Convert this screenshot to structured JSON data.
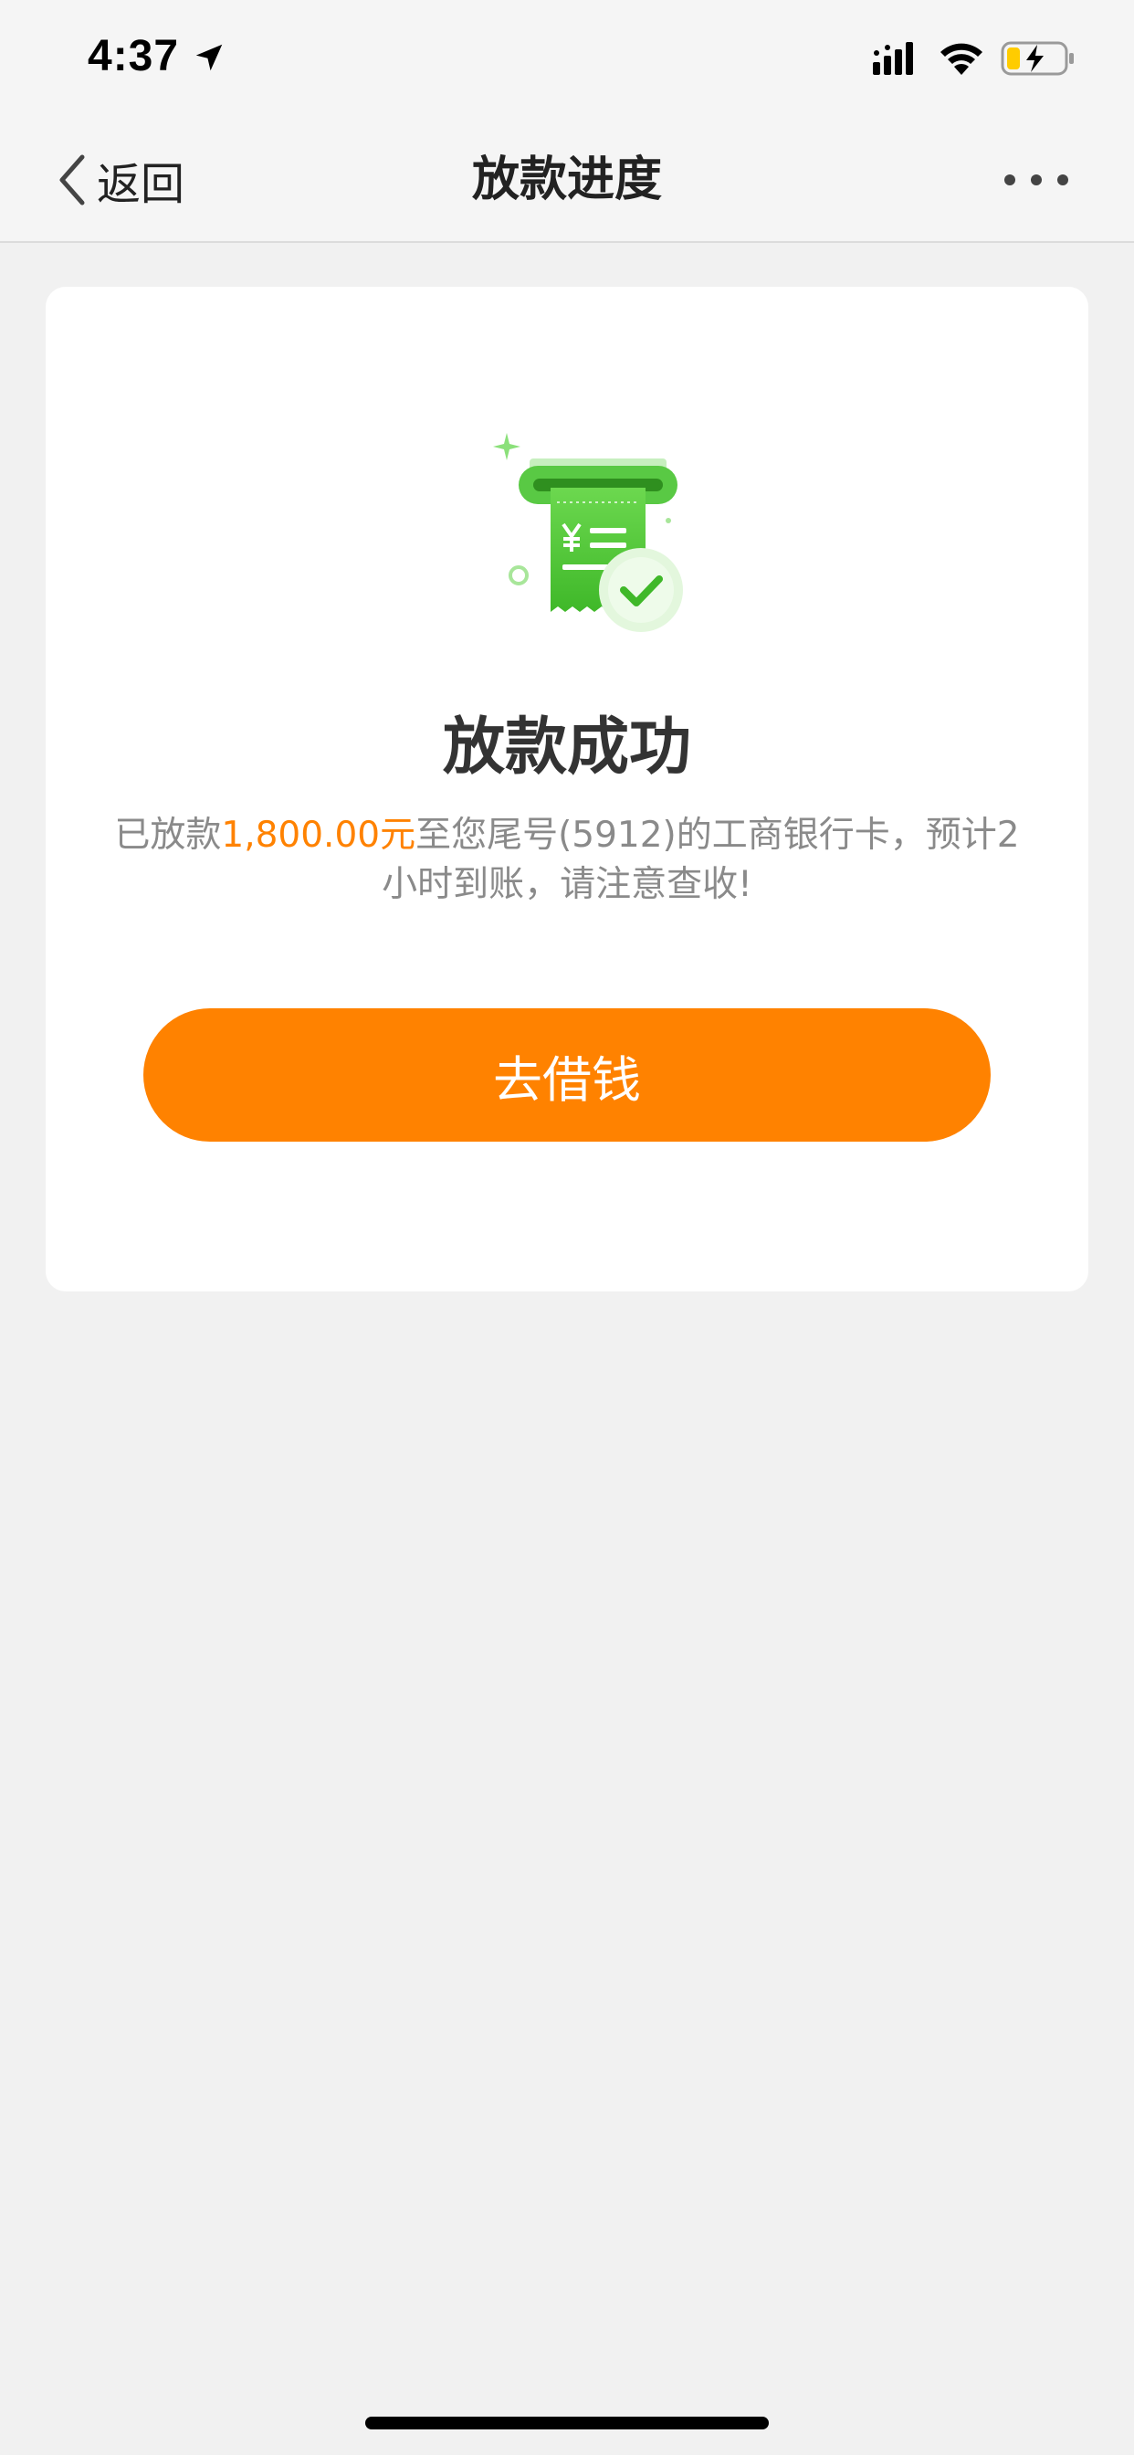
{
  "status_bar": {
    "time": "4:37",
    "icons": [
      "location-arrow-icon",
      "cellular-signal-icon",
      "wifi-icon",
      "battery-charging-icon"
    ]
  },
  "nav": {
    "back_label": "返回",
    "title": "放款进度",
    "more_icon": "more-dots-icon"
  },
  "result": {
    "illustration": "receipt-success-icon",
    "title": "放款成功",
    "desc_prefix": "已放款",
    "amount": "1,800.00元",
    "desc_suffix": "至您尾号(5912)的工商银行卡，预计2小时到账，请注意查收!"
  },
  "action": {
    "button_label": "去借钱"
  },
  "colors": {
    "accent": "#ff8200",
    "background": "#f1f1f1",
    "card": "#ffffff",
    "success_green": "#4cc637"
  }
}
